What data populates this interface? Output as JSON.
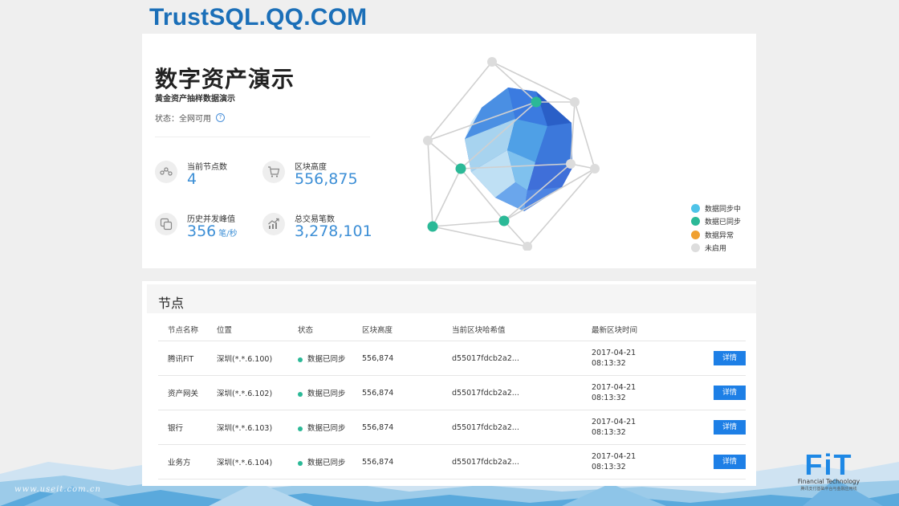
{
  "site_title": "TrustSQL.QQ.COM",
  "overview": {
    "title": "数字资产演示",
    "subtitle": "黄金资产抽样数据演示",
    "status": "状态：全网可用",
    "stats": [
      {
        "label": "当前节点数",
        "value": "4",
        "unit": "",
        "icon": "nodes-icon"
      },
      {
        "label": "区块高度",
        "value": "556,875",
        "unit": "",
        "icon": "cart-icon"
      },
      {
        "label": "历史并发峰值",
        "value": "356",
        "unit": "笔/秒",
        "icon": "copy-icon"
      },
      {
        "label": "总交易笔数",
        "value": "3,278,101",
        "unit": "",
        "icon": "trend-chart-icon"
      }
    ],
    "legend": [
      {
        "label": "数据同步中",
        "color": "#4fc3e8"
      },
      {
        "label": "数据已同步",
        "color": "#2bb997"
      },
      {
        "label": "数据异常",
        "color": "#f0a030"
      },
      {
        "label": "未启用",
        "color": "#dddddd"
      }
    ]
  },
  "nodes": {
    "title": "节点",
    "columns": [
      "节点名称",
      "位置",
      "状态",
      "区块高度",
      "当前区块哈希值",
      "最新区块时间"
    ],
    "rows": [
      {
        "name": "腾讯FiT",
        "location": "深圳(*.*.6.100)",
        "status": "数据已同步",
        "height": "556,874",
        "hash": "d55017fdcb2a2...",
        "date": "2017-04-21",
        "time": "08:13:32",
        "action": "详情"
      },
      {
        "name": "资产网关",
        "location": "深圳(*.*.6.102)",
        "status": "数据已同步",
        "height": "556,874",
        "hash": "d55017fdcb2a2...",
        "date": "2017-04-21",
        "time": "08:13:32",
        "action": "详情"
      },
      {
        "name": "银行",
        "location": "深圳(*.*.6.103)",
        "status": "数据已同步",
        "height": "556,874",
        "hash": "d55017fdcb2a2...",
        "date": "2017-04-21",
        "time": "08:13:32",
        "action": "详情"
      },
      {
        "name": "业务方",
        "location": "深圳(*.*.6.104)",
        "status": "数据已同步",
        "height": "556,874",
        "hash": "d55017fdcb2a2...",
        "date": "2017-04-21",
        "time": "08:13:32",
        "action": "详情"
      }
    ]
  },
  "footer": {
    "url": "www.useit.com.cn",
    "logo_text": "FiT",
    "logo_sub": "Financial Technology",
    "logo_sub2": "腾讯支付基础平台与金融应用线"
  }
}
